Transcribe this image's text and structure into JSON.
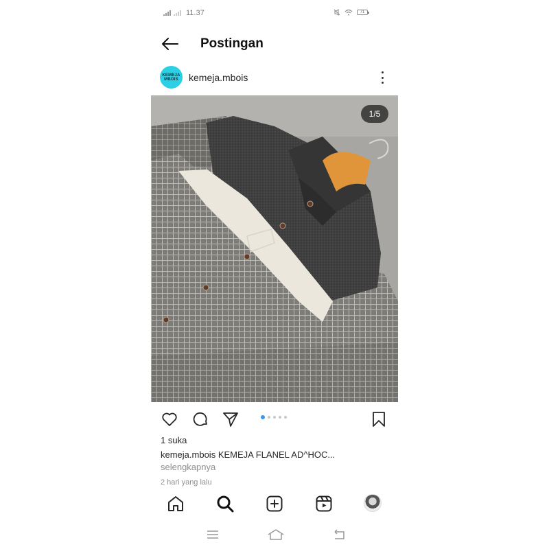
{
  "status_bar": {
    "time": "11.37",
    "battery": "71"
  },
  "header": {
    "title": "Postingan",
    "back_icon": "arrow-left-icon"
  },
  "post": {
    "username": "kemeja.mbois",
    "avatar_text_line1": "KEMEJA",
    "avatar_text_line2": "MBOIS",
    "avatar_color": "#2bd0e4",
    "photo_counter": "1/5",
    "carousel": {
      "count": 5,
      "active_index": 0
    },
    "likes": "1 suka",
    "caption_user": "kemeja.mbois",
    "caption_text": "KEMEJA FLANEL AD^HOC...",
    "more_link": "selengkapnya",
    "time": "2 hari yang lalu"
  },
  "actions": [
    "heart-icon",
    "comment-icon",
    "share-icon",
    "bookmark-icon"
  ],
  "bottom_nav": [
    "home-icon",
    "search-icon",
    "add-post-icon",
    "reels-icon",
    "profile-avatar"
  ],
  "system_nav": [
    "menu-icon",
    "home-icon",
    "back-icon"
  ],
  "colors": {
    "accent": "#3897f0",
    "text": "#262626",
    "muted": "#8e8e8e"
  }
}
